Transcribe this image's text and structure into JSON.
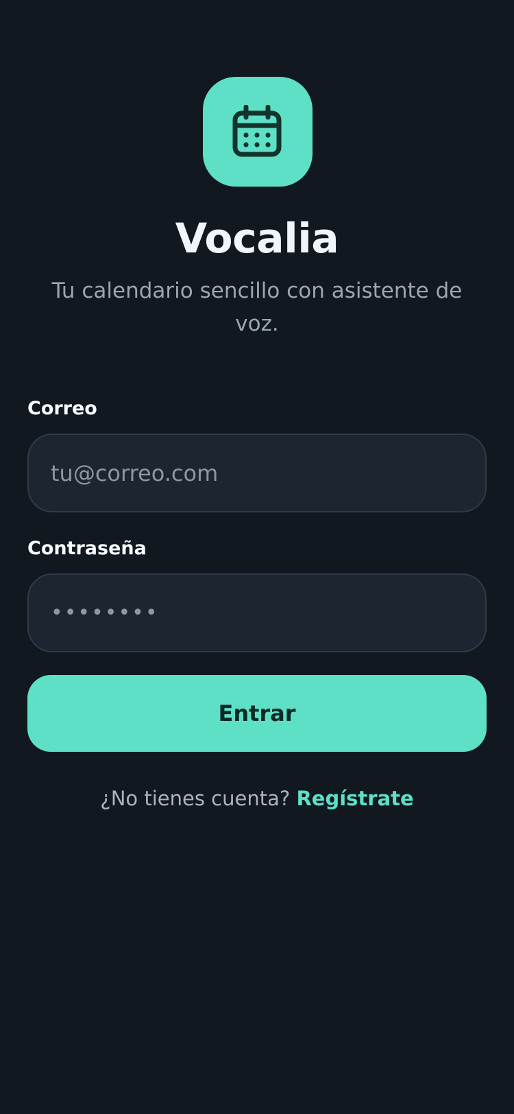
{
  "app": {
    "icon": "calendar-icon",
    "title": "Vocalia",
    "tagline": "Tu calendario sencillo con asistente de voz."
  },
  "colors": {
    "background": "#111820",
    "accent": "#5ee0c6",
    "input_background": "#1c2530",
    "muted_text": "#9aa6b2"
  },
  "login_form": {
    "email_label": "Correo",
    "email_placeholder": "tu@correo.com",
    "password_label": "Contraseña",
    "password_value": "••••••••",
    "submit_label": "Entrar"
  },
  "signup": {
    "prompt": "¿No tienes cuenta?",
    "link_label": "Regístrate"
  }
}
